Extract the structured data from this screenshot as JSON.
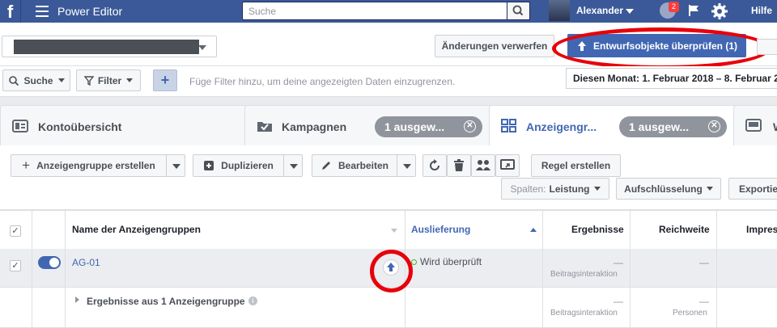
{
  "topbar": {
    "logo": "f",
    "menu_icon": "hamburger-icon",
    "app_title": "Power Editor",
    "search_placeholder": "Suche",
    "user_name": "Alexander",
    "notification_count": "2",
    "help_label": "Hilfe"
  },
  "actions": {
    "discard_label": "Änderungen verwerfen",
    "review_label": "Entwurfsobjekte überprüfen (1)"
  },
  "filters": {
    "search_label": "Suche",
    "filter_label": "Filter",
    "add_label": "+",
    "hint": "Füge Filter hinzu, um deine angezeigten Daten einzugrenzen.",
    "date_range": "Diesen Monat: 1. Februar 2018 – 8. Februar 2018"
  },
  "tabs": [
    {
      "label": "Kontoübersicht",
      "icon": "account-overview-icon"
    },
    {
      "label": "Kampagnen",
      "icon": "folder-icon",
      "pill": "1 ausgew..."
    },
    {
      "label": "Anzeigengr...",
      "icon": "grid-icon",
      "pill": "1 ausgew..."
    },
    {
      "label": "W",
      "icon": "ad-icon"
    }
  ],
  "toolbar": {
    "create_label": "Anzeigengruppe erstellen",
    "duplicate_label": "Duplizieren",
    "edit_label": "Bearbeiten",
    "rule_label": "Regel erstellen",
    "columns_label": "Spalten:",
    "columns_value": "Leistung",
    "breakdown_label": "Aufschlüsselung",
    "export_label": "Exportie"
  },
  "table": {
    "headers": {
      "name": "Name der Anzeigengruppen",
      "delivery": "Auslieferung",
      "results": "Ergebnisse",
      "reach": "Reichweite",
      "impressions": "Impres"
    },
    "row": {
      "name": "AG-01",
      "delivery": "Wird überprüft",
      "results": "—",
      "results_sub": "Beitragsinteraktion",
      "reach": "—"
    },
    "summary": {
      "label": "Ergebnisse aus 1 Anzeigengruppe",
      "results": "—",
      "results_sub": "Beitragsinteraktion",
      "reach": "—",
      "reach_sub": "Personen"
    }
  }
}
